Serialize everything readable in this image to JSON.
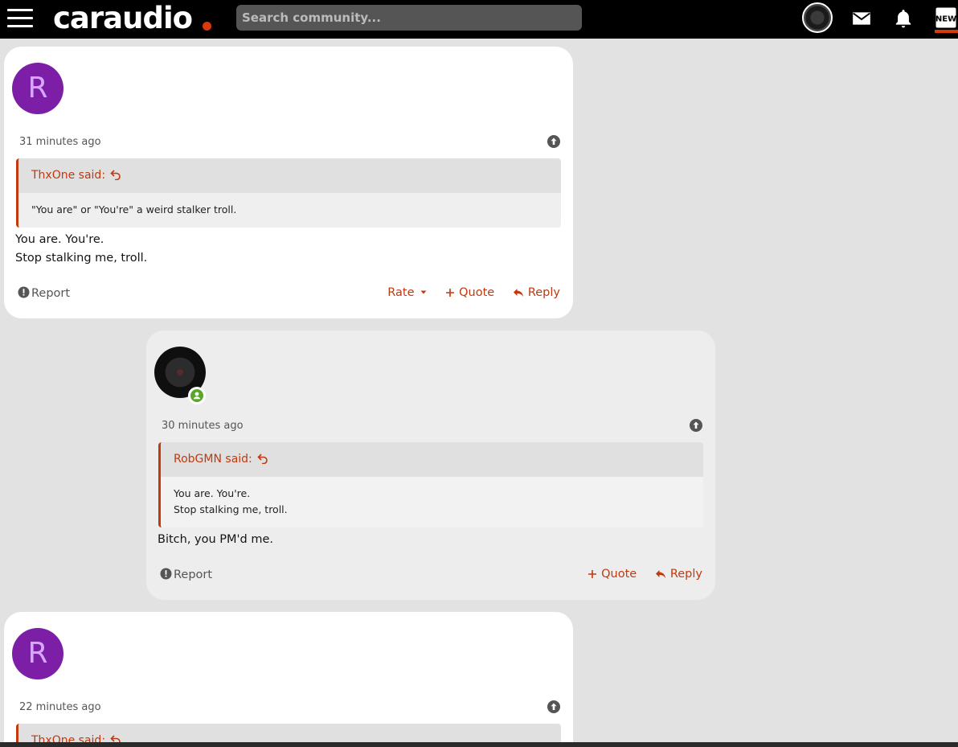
{
  "topbar": {
    "logo_text": "caraudio",
    "search_placeholder": "Search community...",
    "accent_color": "#d83a0c",
    "icons": [
      "menu-icon",
      "user-avatar",
      "mail-icon",
      "bell-icon",
      "new-icon"
    ]
  },
  "posts": [
    {
      "avatar_letter": "R",
      "avatar_color": "#7c1fa6",
      "timestamp": "31 minutes ago",
      "quote_author": "ThxOne said:",
      "quote_lines": [
        "\"You are\" or \"You're\" a weird stalker troll."
      ],
      "body_lines": [
        "You are. You're.",
        "Stop stalking me, troll."
      ],
      "report_label": "Report",
      "rate_label": "Rate",
      "quote_label": "Quote",
      "reply_label": "Reply"
    },
    {
      "avatar_type": "image",
      "timestamp": "30 minutes ago",
      "quote_author": "RobGMN said:",
      "quote_lines": [
        "You are. You're.",
        "Stop stalking me, troll."
      ],
      "body_lines": [
        "Bitch, you PM'd me."
      ],
      "report_label": "Report",
      "quote_label": "Quote",
      "reply_label": "Reply"
    },
    {
      "avatar_letter": "R",
      "avatar_color": "#7c1fa6",
      "timestamp": "22 minutes ago",
      "quote_author": "ThxOne said:"
    }
  ]
}
